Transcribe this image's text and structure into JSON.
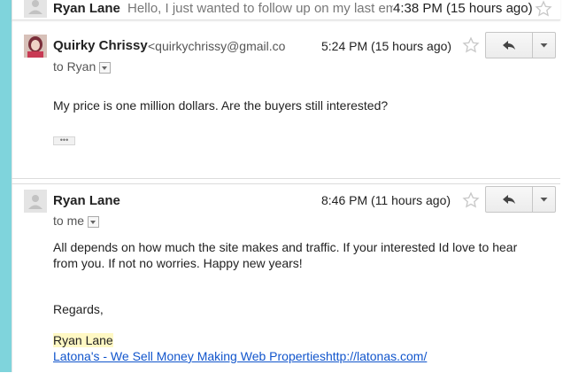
{
  "thread": {
    "collapsed_message": {
      "sender": "Ryan Lane",
      "snippet": "Hello, I just wanted to follow up on my last em",
      "time": "4:38 PM (15 hours ago)"
    },
    "messages": [
      {
        "sender": "Quirky Chrissy",
        "email": "<quirkychrissy@gmail.co",
        "time": "5:24 PM (15 hours ago)",
        "to": "to Ryan",
        "body": "My price is one million dollars. Are the buyers still interested?"
      },
      {
        "sender": "Ryan Lane",
        "time": "8:46 PM (11 hours ago)",
        "to": "to me",
        "body_line1": "All depends on how much the site makes and traffic. If your interested Id love to hear",
        "body_line2": "from you. If not no worries. Happy new years!",
        "regards": "Regards,",
        "sig_name": "Ryan Lane",
        "sig_link": "Latona's - We Sell Money Making Web Propertieshttp://latonas.com/"
      }
    ]
  },
  "colors": {
    "left_bar": "#7fd4dc",
    "link": "#1155cc",
    "highlight": "#fff8c4"
  }
}
